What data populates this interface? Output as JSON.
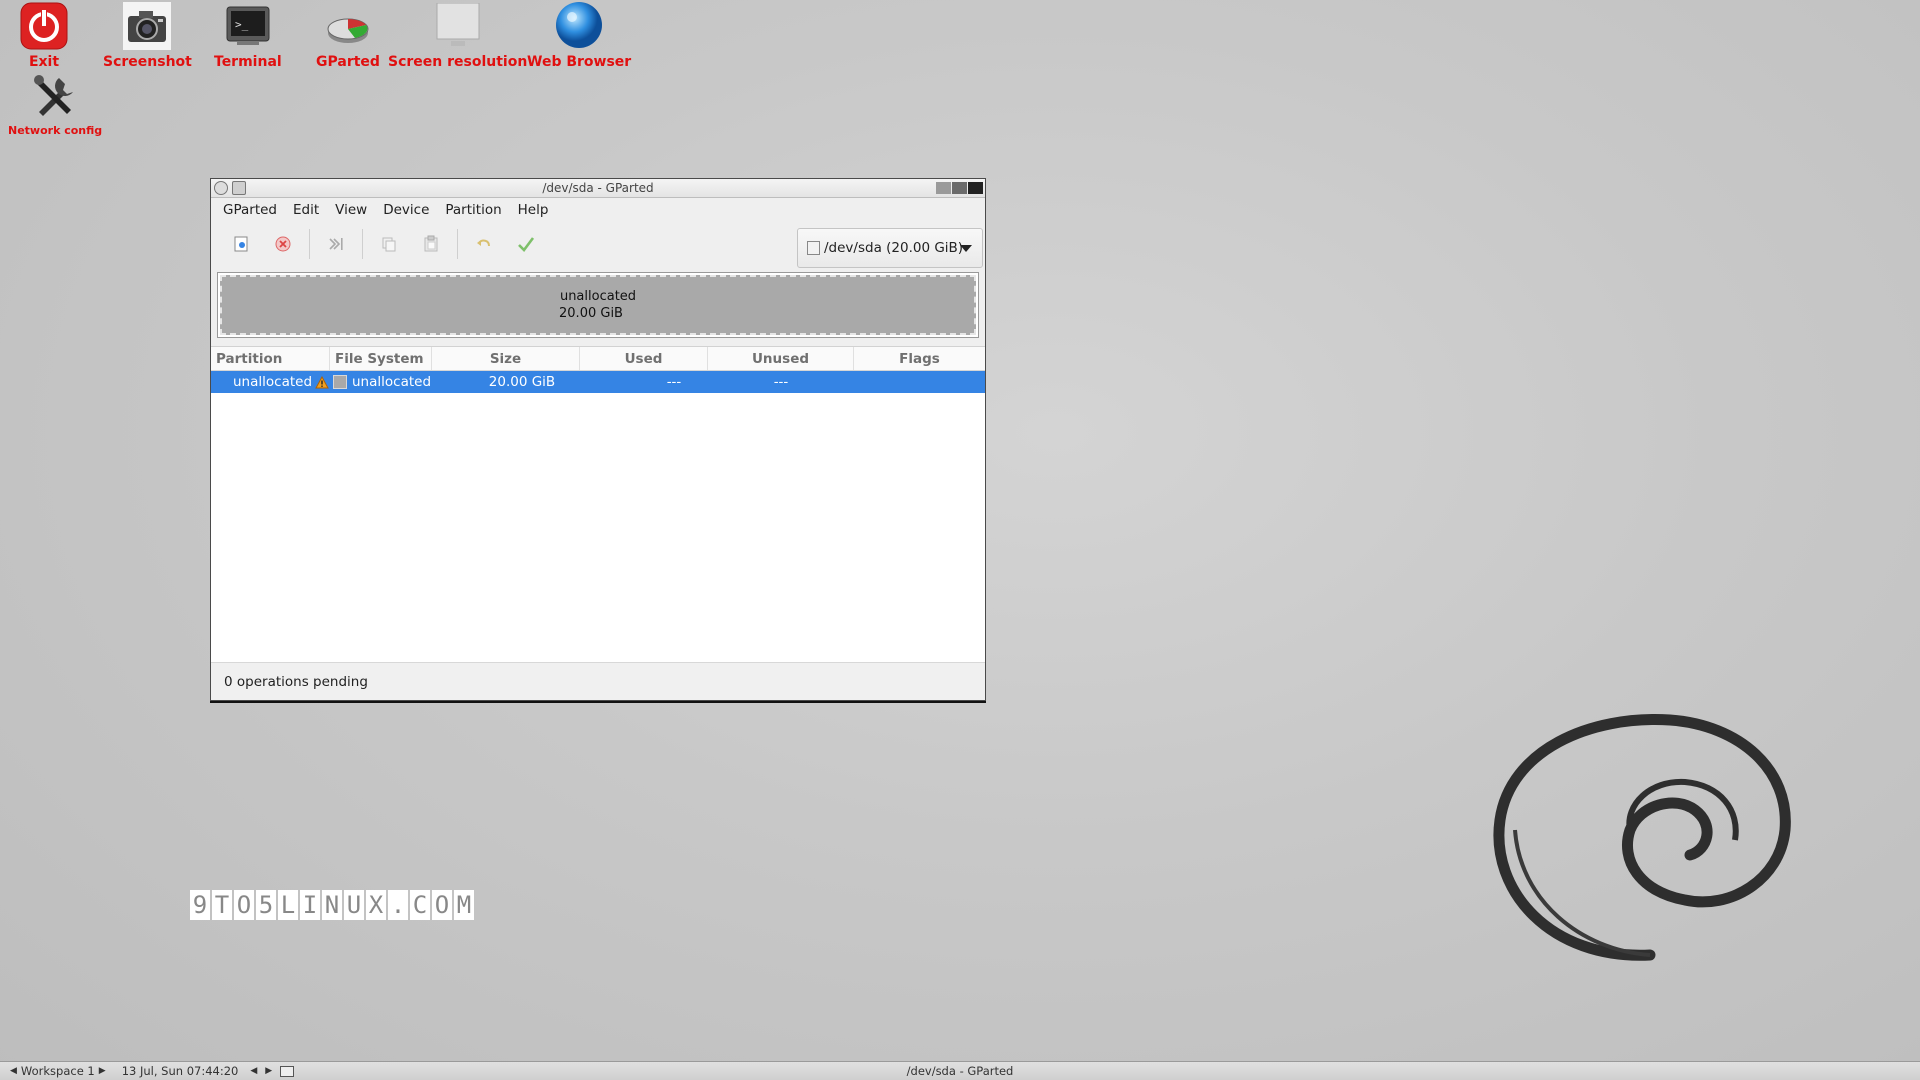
{
  "desktop": {
    "icons": [
      {
        "label": "Exit"
      },
      {
        "label": "Screenshot"
      },
      {
        "label": "Terminal"
      },
      {
        "label": "GParted"
      },
      {
        "label": "Screen resolution"
      },
      {
        "label": "Web Browser"
      },
      {
        "label": "Network config"
      }
    ],
    "watermark": [
      "9",
      "T",
      "O",
      "5",
      "L",
      "I",
      "N",
      "U",
      "X",
      ".",
      "C",
      "O",
      "M"
    ]
  },
  "window": {
    "title": "/dev/sda - GParted",
    "menu": [
      "GParted",
      "Edit",
      "View",
      "Device",
      "Partition",
      "Help"
    ],
    "device_selector": "/dev/sda (20.00 GiB)",
    "graph": {
      "label": "unallocated",
      "size": "20.00 GiB"
    },
    "table": {
      "headers": [
        "Partition",
        "File System",
        "Size",
        "Used",
        "Unused",
        "Flags"
      ],
      "rows": [
        {
          "partition": "unallocated",
          "filesystem": "unallocated",
          "size": "20.00 GiB",
          "used": "---",
          "unused": "---",
          "flags": ""
        }
      ]
    },
    "status": "0 operations pending"
  },
  "taskbar": {
    "workspace": "Workspace 1",
    "clock": "13 Jul, Sun 07:44:20",
    "task": "/dev/sda - GParted"
  },
  "colors": {
    "selection": "#3584e4",
    "desktop_label": "#e01010",
    "unallocated": "#a9a9a9"
  }
}
